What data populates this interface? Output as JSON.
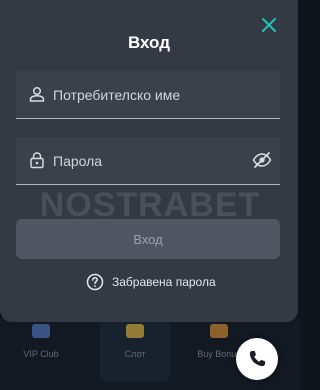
{
  "background_nav": {
    "items": [
      {
        "label": "VIP Club",
        "icon": "vip-icon",
        "color": "#4a6fb4"
      },
      {
        "label": "Слот",
        "icon": "slot-icon",
        "color": "#c9a23a"
      },
      {
        "label": "Buy Bonus",
        "icon": "bonus-icon",
        "color": "#c2802e"
      }
    ]
  },
  "modal": {
    "title": "Вход",
    "username": {
      "placeholder": "Потребителско име",
      "value": ""
    },
    "password": {
      "placeholder": "Парола",
      "value": ""
    },
    "submit_label": "Вход",
    "forgot_label": "Забравена парола",
    "watermark": "NOSTRABET"
  },
  "colors": {
    "accent": "#21c6b5",
    "modal_bg": "#343a44",
    "field_bg": "#3b414b",
    "button_bg": "#4f5661"
  }
}
